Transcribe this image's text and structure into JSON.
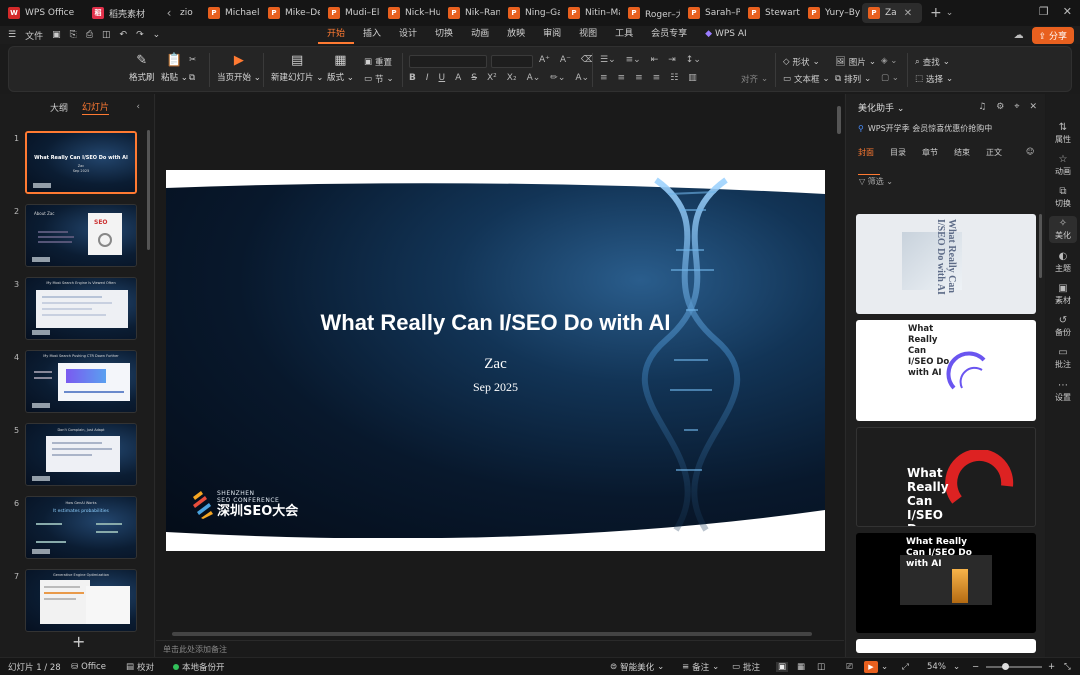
{
  "tabs": [
    {
      "label": "WPS Office",
      "icon": "wps-logo-icon",
      "color": "#d42a2a"
    },
    {
      "label": "稻壳素材",
      "icon": "daoke-icon",
      "color": "#e0304a"
    },
    {
      "label": "zio",
      "icon": "",
      "color": ""
    },
    {
      "label": "Michael–",
      "icon": "ppt-file-icon",
      "color": "#e8601f"
    },
    {
      "label": "Mike–Dec",
      "icon": "ppt-file-icon",
      "color": "#e8601f"
    },
    {
      "label": "Mudi–Elo",
      "icon": "ppt-file-icon",
      "color": "#e8601f"
    },
    {
      "label": "Nick–Hu",
      "icon": "ppt-file-icon",
      "color": "#e8601f"
    },
    {
      "label": "Nik–Rang",
      "icon": "ppt-file-icon",
      "color": "#e8601f"
    },
    {
      "label": "Ning–Gan",
      "icon": "ppt-file-icon",
      "color": "#e8601f"
    },
    {
      "label": "Nitin–Ma",
      "icon": "ppt-file-icon",
      "color": "#e8601f"
    },
    {
      "label": "Roger–大",
      "icon": "ppt-file-icon",
      "color": "#e8601f"
    },
    {
      "label": "Sarah–Pe",
      "icon": "ppt-file-icon",
      "color": "#e8601f"
    },
    {
      "label": "Stewart–",
      "icon": "ppt-file-icon",
      "color": "#e8601f"
    },
    {
      "label": "Yury–Byp",
      "icon": "ppt-file-icon",
      "color": "#e8601f"
    },
    {
      "label": "Za",
      "icon": "ppt-file-icon",
      "color": "#e8601f"
    }
  ],
  "menu": {
    "file": "文件",
    "tabs": [
      "开始",
      "插入",
      "设计",
      "切换",
      "动画",
      "放映",
      "审阅",
      "视图",
      "工具",
      "会员专享",
      "WPS AI"
    ],
    "active_tab": "开始",
    "share": "分享"
  },
  "ribbon": {
    "format_painter": "格式刷",
    "paste": "粘贴",
    "play_from_current": "当页开始",
    "new_slide": "新建幻灯片",
    "layout": "版式",
    "reset": "重置",
    "section": "节",
    "align": "对齐",
    "shape": "形状",
    "picture": "图片",
    "textbox": "文本框",
    "arrange": "排列",
    "find": "查找",
    "select": "选择"
  },
  "left_pane": {
    "tab_outline": "大纲",
    "tab_slides": "幻灯片",
    "thumbnails": [
      {
        "num": "1",
        "title": "What Really Can I/SEO Do with AI",
        "sub1": "Zac",
        "sub2": "Sep 2025"
      },
      {
        "num": "2",
        "title": "About Zac",
        "sub1": "",
        "sub2": ""
      },
      {
        "num": "3",
        "title": "My Most Search Engine Is Viewed Often",
        "sub1": "",
        "sub2": ""
      },
      {
        "num": "4",
        "title": "My Most Search Pushing CTR Down Further",
        "sub1": "",
        "sub2": ""
      },
      {
        "num": "5",
        "title": "Don't Complain, Just Adapt",
        "sub1": "",
        "sub2": ""
      },
      {
        "num": "6",
        "title": "How GenAI Works",
        "sub1": "It estimates probabilities",
        "sub2": ""
      },
      {
        "num": "7",
        "title": "Generative Engine Optimization",
        "sub1": "",
        "sub2": ""
      }
    ]
  },
  "slide": {
    "title": "What Really Can I/SEO Do with AI",
    "author": "Zac",
    "date": "Sep 2025",
    "logo_en_1": "SHENZHEN",
    "logo_en_2": "SEO CONFERENCE",
    "logo_cn": "深圳SEO大会"
  },
  "notes_placeholder": "单击此处添加备注",
  "right_panel": {
    "title": "美化助手",
    "promo": "WPS开学季 会员惊喜优惠价抢购中",
    "tabs": [
      "封面",
      "目录",
      "章节",
      "结束",
      "正文"
    ],
    "active_tab": "封面",
    "filter": "筛选",
    "card_texts": [
      "What Really Can I/SEO Do with AI",
      "What Really Can I/SEO Do with AI",
      "What Really Can I/SEO Do with",
      "What Really Can I/SEO Do with AI"
    ]
  },
  "rail": [
    "属性",
    "动画",
    "切换",
    "美化",
    "主题",
    "素材",
    "备份",
    "批注",
    "设置"
  ],
  "rail_active": "美化",
  "status": {
    "slide_counter": "幻灯片 1 / 28",
    "theme": "Office",
    "proof": "校对",
    "backup": "本地备份开",
    "smart": "智能美化",
    "notes": "备注",
    "comments": "批注",
    "zoom": "54%"
  },
  "colors": {
    "accent": "#ff7a32",
    "share_bg": "#e8601f",
    "backup_dot": "#32c05a"
  }
}
